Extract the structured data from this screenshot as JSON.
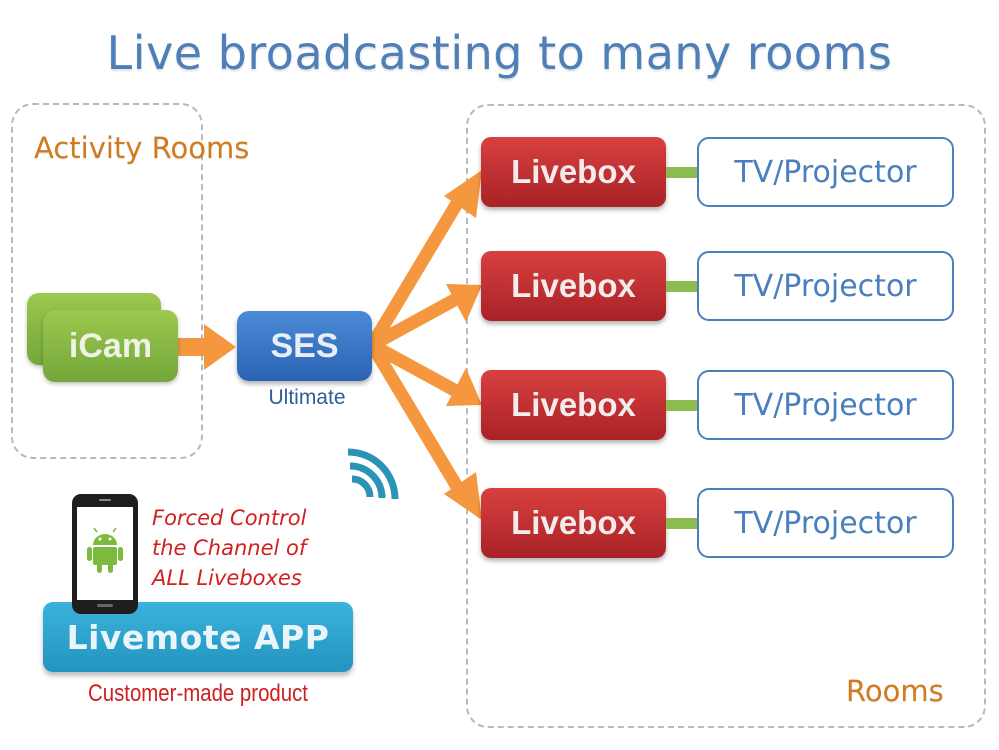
{
  "title": "Live broadcasting to many rooms",
  "activity_rooms": {
    "label": "Activity Rooms",
    "source": "iCam"
  },
  "server": {
    "label": "SES",
    "sublabel": "Ultimate"
  },
  "rooms": {
    "label": "Rooms",
    "rows": [
      {
        "receiver": "Livebox",
        "display": "TV/Projector"
      },
      {
        "receiver": "Livebox",
        "display": "TV/Projector"
      },
      {
        "receiver": "Livebox",
        "display": "TV/Projector"
      },
      {
        "receiver": "Livebox",
        "display": "TV/Projector"
      }
    ]
  },
  "app": {
    "label": "Livemote APP",
    "note_lines": [
      "Forced Control",
      "the Channel of",
      "ALL Liveboxes"
    ],
    "sublabel": "Customer-made product",
    "device_icon": "android-phone-icon",
    "signal_icon": "wifi-signal-icon"
  },
  "colors": {
    "title": "#4f7fb8",
    "orange_label": "#d27b1e",
    "arrow": "#f4973f",
    "icam": "#84b744",
    "ses": "#3a78c8",
    "livebox": "#c23134",
    "tv_border": "#4a7fbe",
    "connector": "#8cbb4f",
    "app": "#2fa6d1",
    "note": "#d02121",
    "signal": "#2b93b5"
  }
}
